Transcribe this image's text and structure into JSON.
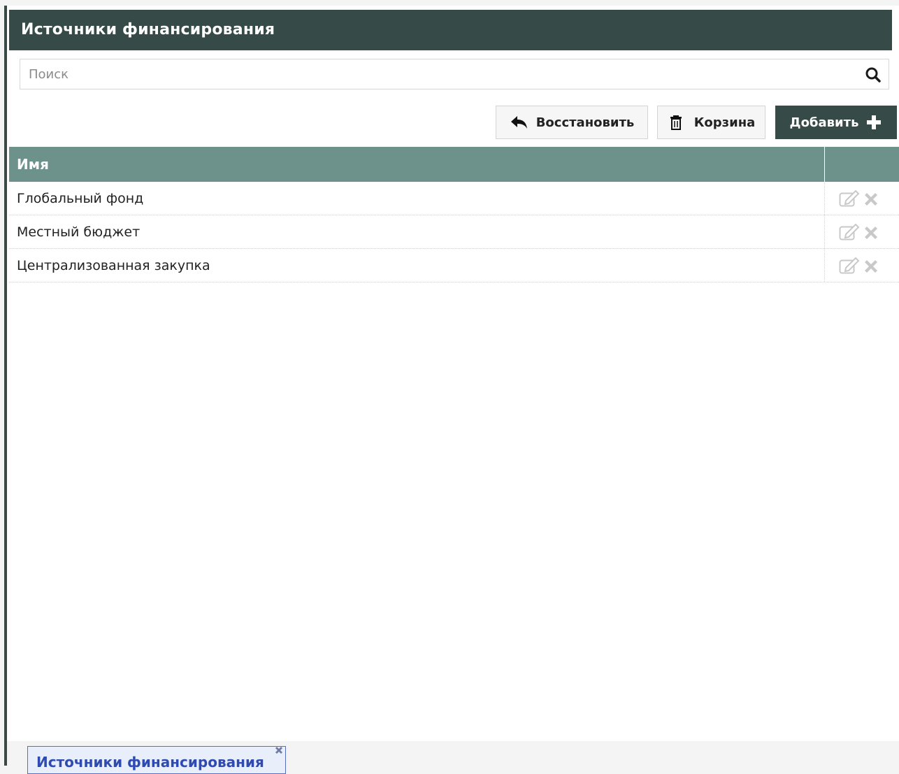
{
  "window": {
    "title": "Источники финансирования"
  },
  "search": {
    "placeholder": "Поиск",
    "value": ""
  },
  "toolbar": {
    "restore_label": "Восстановить",
    "trash_label": "Корзина",
    "add_label": "Добавить"
  },
  "table": {
    "header": {
      "name": "Имя"
    },
    "rows": [
      {
        "name": "Глобальный фонд"
      },
      {
        "name": "Местный бюджет"
      },
      {
        "name": "Централизованная закупка"
      }
    ]
  },
  "bottom_tab": {
    "label": "Источники финансирования"
  },
  "colors": {
    "titlebar": "#364b47",
    "table_header": "#6d918b",
    "add_button": "#364b47",
    "tab_text": "#2f4bb0"
  },
  "icons": {
    "search": "search-icon",
    "restore": "undo-arrow-icon",
    "trash": "trash-icon",
    "add": "plus-icon",
    "edit": "edit-icon",
    "delete": "delete-x-icon",
    "tab_close": "close-icon"
  }
}
